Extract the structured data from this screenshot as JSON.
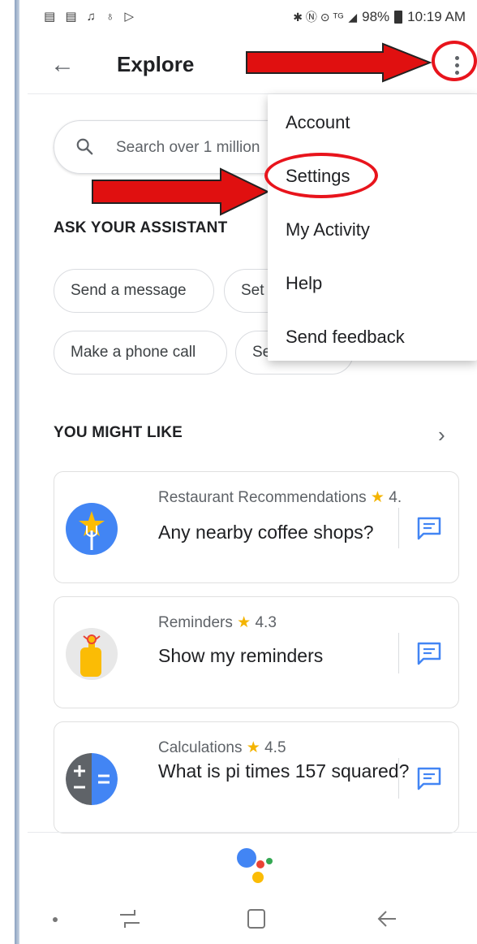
{
  "status_bar": {
    "left_icons": "▤ ▤ ♫ ♁ ▷",
    "right_icons": "✱ Ⓝ ⊙ ᵀᴳ",
    "battery": "98%",
    "time": "10:19 AM"
  },
  "app_bar": {
    "title": "Explore"
  },
  "search": {
    "placeholder": "Search over 1 million"
  },
  "ask_section": {
    "heading": "ASK YOUR ASSISTANT",
    "chips": [
      "Send a message",
      "Set",
      "Make a phone call",
      "Se"
    ]
  },
  "might_like": {
    "heading": "YOU MIGHT LIKE",
    "cards": [
      {
        "category": "Restaurant Recommendations",
        "rating": "4.",
        "query": "Any nearby coffee shops?",
        "icon": "restaurant-icon"
      },
      {
        "category": "Reminders",
        "rating": "4.3",
        "query": "Show my reminders",
        "icon": "reminder-hand-icon"
      },
      {
        "category": "Calculations",
        "rating": "4.5",
        "query": "What is pi times 157 squared?",
        "icon": "calculator-icon"
      }
    ]
  },
  "menu": {
    "items": [
      "Account",
      "Settings",
      "My Activity",
      "Help",
      "Send feedback"
    ]
  },
  "colors": {
    "annotation_red": "#e8141c",
    "google_blue": "#4285f4",
    "google_red": "#ea4335",
    "google_yellow": "#fbbc05",
    "google_green": "#34a853"
  }
}
